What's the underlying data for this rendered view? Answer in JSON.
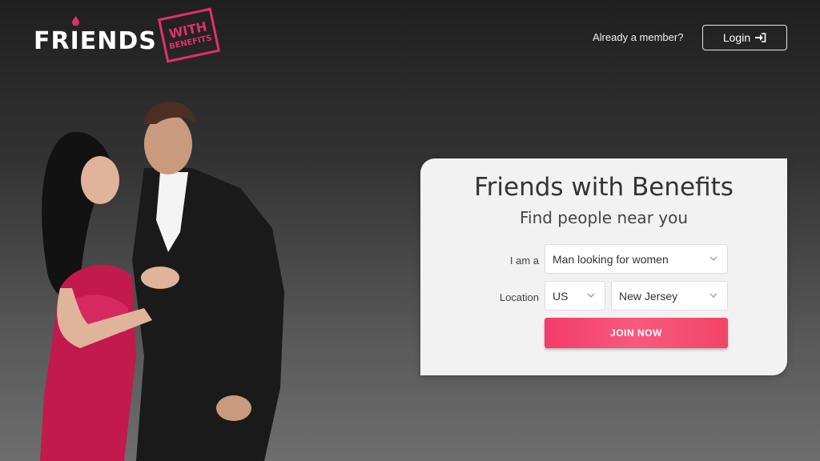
{
  "header": {
    "logo": {
      "word": "FRIENDS",
      "stamp_line1": "WITH",
      "stamp_line2": "BENEFITS"
    },
    "member_prompt": "Already a member?",
    "login_label": "Login"
  },
  "form": {
    "title": "Friends with Benefits",
    "subtitle": "Find people near you",
    "iam_label": "I am a",
    "iam_value": "Man looking for women",
    "location_label": "Location",
    "country_value": "US",
    "state_value": "New Jersey",
    "join_label": "JOIN NOW"
  },
  "colors": {
    "brand_pink": "#e0306a",
    "button_gradient_start": "#f33b6b",
    "button_gradient_end": "#f34466",
    "card_bg": "#f2f2f2"
  },
  "icons": {
    "login": "login-arrow-icon",
    "dropdown": "chevron-down-icon"
  }
}
